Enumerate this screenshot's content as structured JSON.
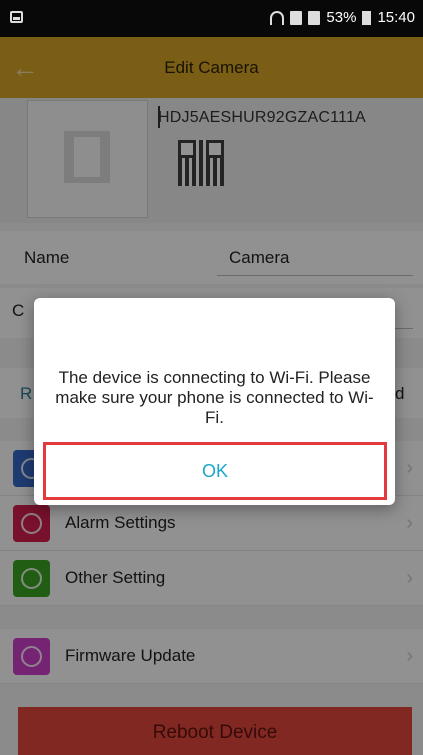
{
  "status_bar": {
    "battery": "53%",
    "time": "15:40"
  },
  "header": {
    "title": "Edit Camera",
    "back_icon": "arrow-left-icon"
  },
  "device": {
    "serial": "HDJ5AESHUR92GZAC111A"
  },
  "form": {
    "name_label": "Name",
    "name_value": "Camera",
    "second_label_partial": "C",
    "hidden_row_left": "R",
    "hidden_row_right": "d"
  },
  "menu": [
    {
      "label": "Alarm Settings",
      "color": "#cf1e4a",
      "icon": "alarm-icon"
    },
    {
      "label": "Other Setting",
      "color": "#3aa321",
      "icon": "settings-icon"
    },
    {
      "label": "Firmware Update",
      "color": "#c83ec4",
      "icon": "firmware-icon"
    }
  ],
  "reboot_label": "Reboot Device",
  "dialog": {
    "message": "The device is connecting to Wi-Fi. Please make sure your phone is connected to Wi-Fi.",
    "ok_label": "OK"
  },
  "colors": {
    "header": "#d4a325",
    "accent": "#1aa7c9",
    "highlight": "#e23a3f"
  }
}
